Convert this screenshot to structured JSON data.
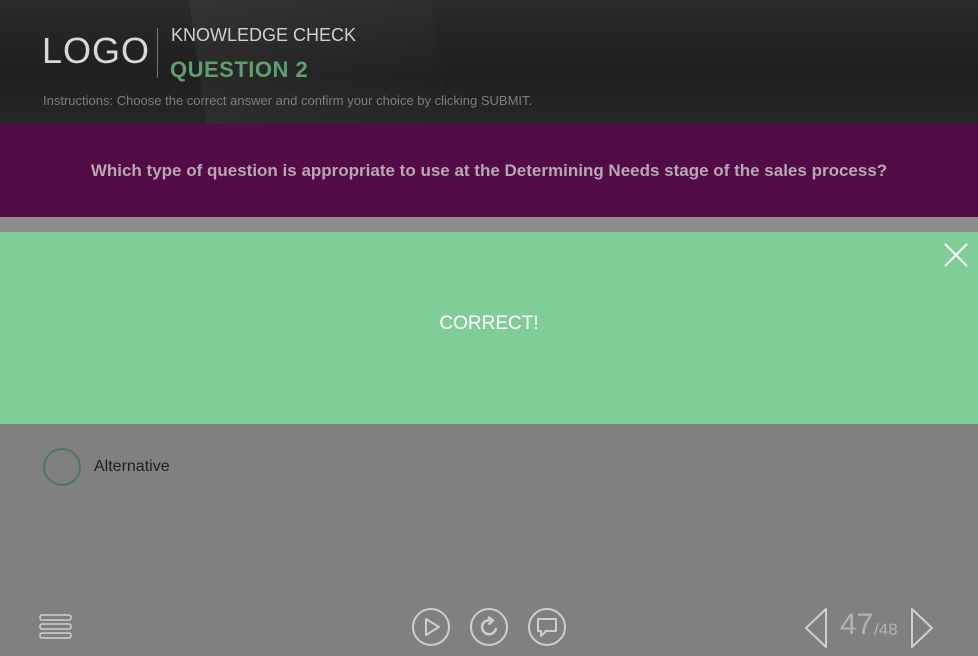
{
  "header": {
    "logo": "LOGO",
    "section_label": "KNOWLEDGE CHECK",
    "question_number": "QUESTION 2",
    "instructions": "Instructions: Choose the correct answer and confirm your choice by clicking SUBMIT."
  },
  "question": {
    "text": "Which type of question is appropriate to use at the Determining Needs stage of the sales process?"
  },
  "feedback": {
    "message": "CORRECT!",
    "close_icon": "close-icon"
  },
  "options": [
    {
      "label": "Alternative",
      "selected": false
    }
  ],
  "footer": {
    "icons": [
      "menu-icon",
      "play-icon",
      "replay-icon",
      "chat-icon",
      "prev-arrow-icon",
      "next-arrow-icon"
    ],
    "page_current": "47",
    "page_total": "/48"
  },
  "colors": {
    "question_band": "#520b45",
    "feedback_background": "#81cd97",
    "accent_green": "#5f9e6e",
    "body_background": "#808080"
  }
}
